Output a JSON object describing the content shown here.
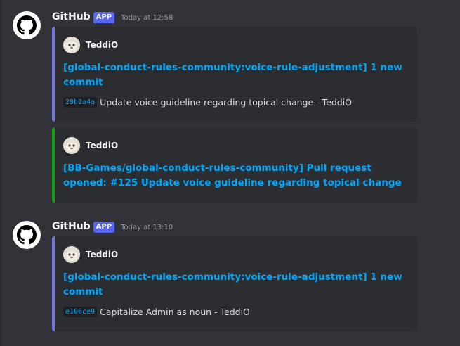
{
  "messages": [
    {
      "author": "GitHub",
      "badge": "APP",
      "timestamp": "Today at 12:58",
      "embeds": [
        {
          "author": "TeddiO",
          "title": "[global-conduct-rules-community:voice-rule-adjustment] 1 new commit",
          "commit_sha": "29b2a4a",
          "commit_text": "Update voice guideline regarding topical change - TeddiO",
          "accent": "#7078e0"
        },
        {
          "author": "TeddiO",
          "title": "[BB-Games/global-conduct-rules-community] Pull request opened: #125 Update voice guideline regarding topical change",
          "accent": "#11a311"
        }
      ]
    },
    {
      "author": "GitHub",
      "badge": "APP",
      "timestamp": "Today at 13:10",
      "embeds": [
        {
          "author": "TeddiO",
          "title": "[global-conduct-rules-community:voice-rule-adjustment] 1 new commit",
          "commit_sha": "e106ce9",
          "commit_text": "Capitalize Admin as noun - TeddiO",
          "accent": "#7078e0"
        }
      ]
    }
  ],
  "icons": {
    "bot_avatar": "github-octocat-icon",
    "embed_author_avatar": "user-avatar"
  }
}
